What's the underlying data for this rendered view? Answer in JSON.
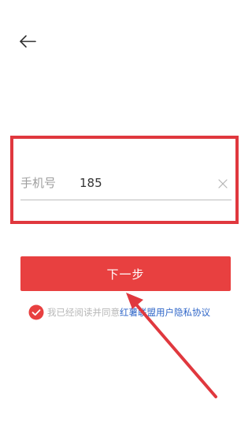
{
  "header": {
    "back_icon": "back-arrow-icon"
  },
  "form": {
    "phone_label": "手机号",
    "phone_value": "185",
    "clear_icon": "clear-x-icon"
  },
  "actions": {
    "next_label": "下一步"
  },
  "agreement": {
    "checked": true,
    "prefix_text": "我已经阅读并同意",
    "link_text": "红薯联盟用户隐私协议"
  },
  "annotation": {
    "highlight_color": "#e0383e",
    "arrow_color": "#e0383e"
  },
  "colors": {
    "primary": "#e84040",
    "link": "#2f66c8",
    "muted_text": "#9e9e9e"
  }
}
